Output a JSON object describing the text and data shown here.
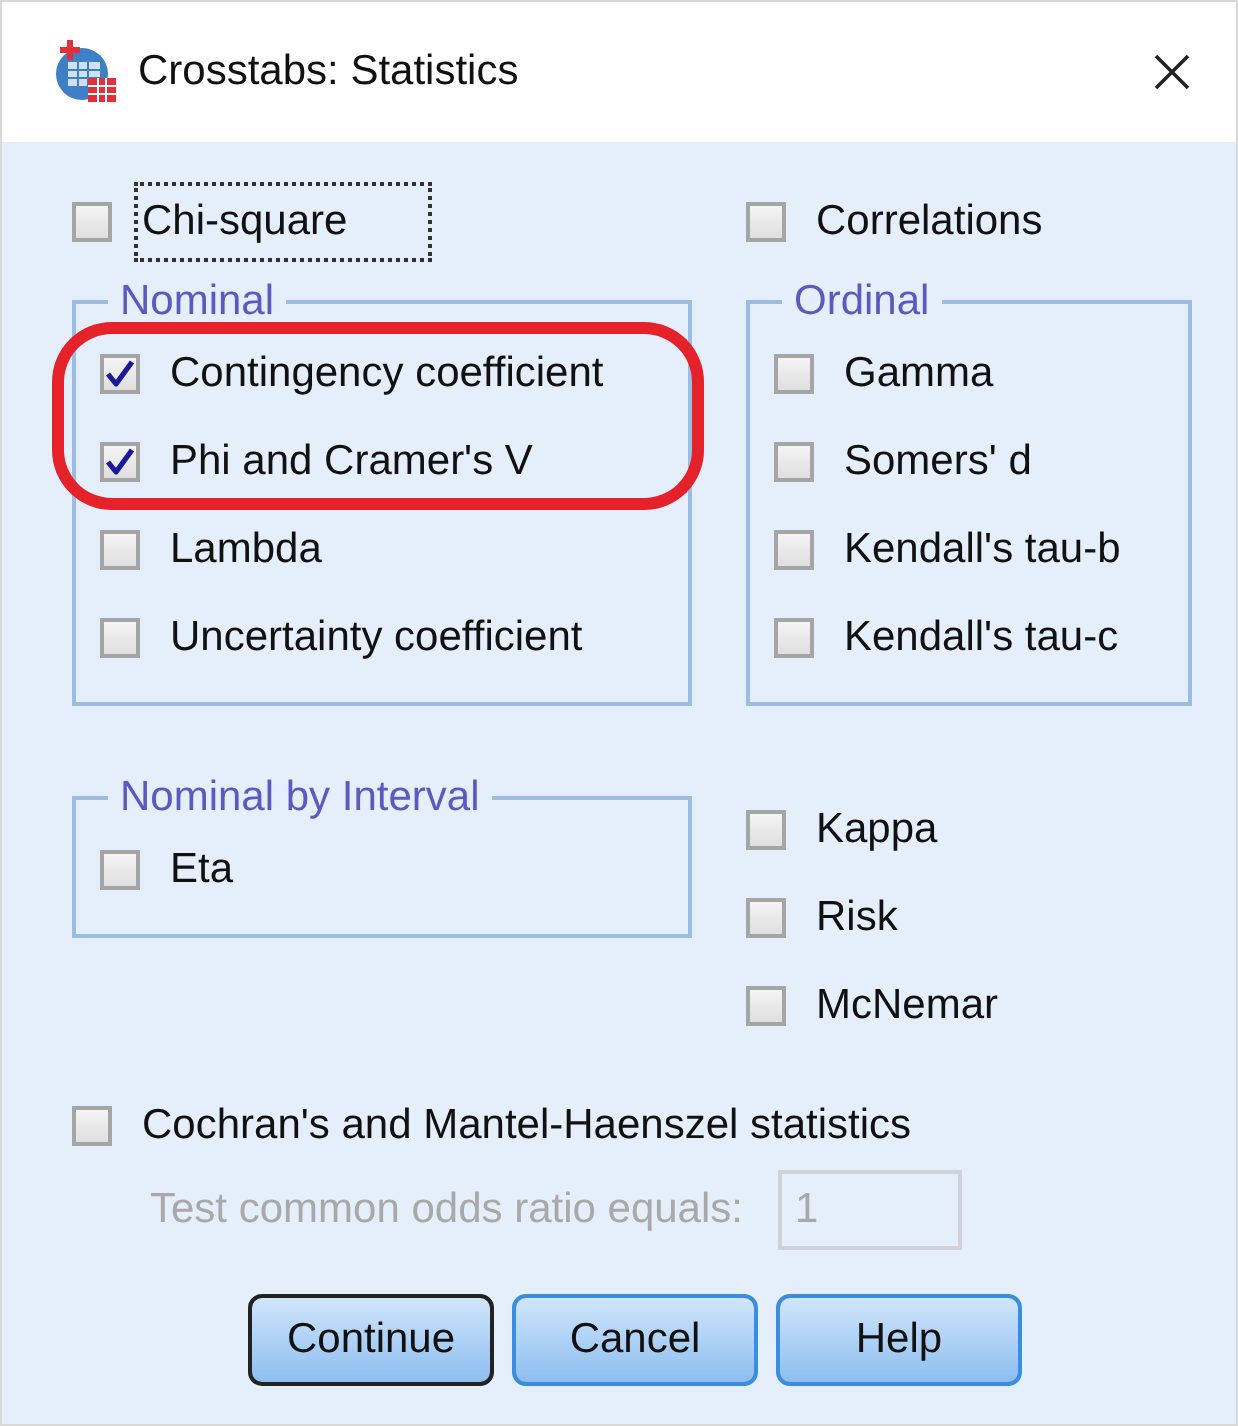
{
  "window": {
    "title": "Crosstabs: Statistics"
  },
  "top_options": [
    {
      "label": "Chi-square",
      "checked": false,
      "focused": true
    },
    {
      "label": "Correlations",
      "checked": false,
      "focused": false
    }
  ],
  "groups": [
    {
      "title": "Nominal",
      "items": [
        {
          "label": "Contingency coefficient",
          "checked": true,
          "highlighted": true
        },
        {
          "label": "Phi and Cramer's V",
          "checked": true,
          "highlighted": true
        },
        {
          "label": "Lambda",
          "checked": false,
          "highlighted": false
        },
        {
          "label": "Uncertainty coefficient",
          "checked": false,
          "highlighted": false
        }
      ]
    },
    {
      "title": "Ordinal",
      "items": [
        {
          "label": "Gamma",
          "checked": false,
          "highlighted": false
        },
        {
          "label": "Somers' d",
          "checked": false,
          "highlighted": false
        },
        {
          "label": "Kendall's tau-b",
          "checked": false,
          "highlighted": false
        },
        {
          "label": "Kendall's tau-c",
          "checked": false,
          "highlighted": false
        }
      ]
    },
    {
      "title": "Nominal by Interval",
      "items": [
        {
          "label": "Eta",
          "checked": false,
          "highlighted": false
        }
      ]
    }
  ],
  "other_options": [
    {
      "label": "Kappa",
      "checked": false
    },
    {
      "label": "Risk",
      "checked": false
    },
    {
      "label": "McNemar",
      "checked": false
    }
  ],
  "cochran": {
    "label": "Cochran's and Mantel-Haenszel statistics",
    "checked": false
  },
  "odds_ratio": {
    "label": "Test common odds ratio equals:",
    "value": "1",
    "disabled": true
  },
  "buttons": [
    {
      "label": "Continue",
      "default": true
    },
    {
      "label": "Cancel",
      "default": false
    },
    {
      "label": "Help",
      "default": false
    }
  ],
  "annotation": {
    "kind": "ellipse",
    "color": "#e52129"
  }
}
